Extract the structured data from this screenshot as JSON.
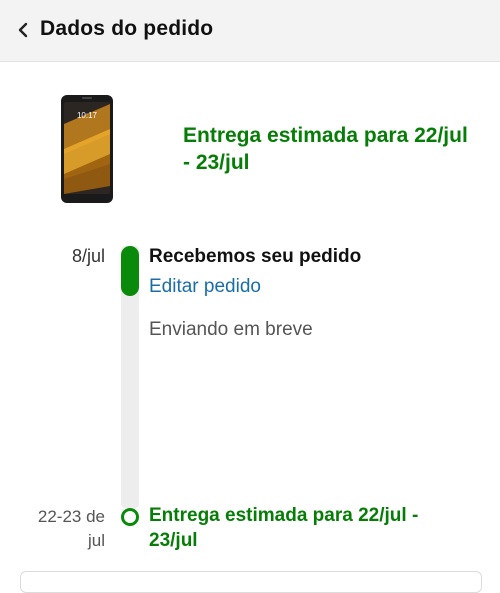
{
  "header": {
    "title": "Dados do pedido",
    "back_icon": "chevron-left-icon"
  },
  "product": {
    "image_icon": "smartphone-image"
  },
  "delivery": {
    "headline": "Entrega estimada para 22/jul - 23/jul"
  },
  "timeline": {
    "ordered_date": "8/jul",
    "ordered_title": "Recebemos seu pedido",
    "edit_link": "Editar pedido",
    "ship_status": "Enviando em breve",
    "delivery_date": "22-23 de jul",
    "delivery_title": "Entrega estimada para 22/jul - 23/jul"
  },
  "colors": {
    "accent_green": "#067d06",
    "link_blue": "#1a6ea7",
    "header_bg": "#f3f3f3"
  }
}
